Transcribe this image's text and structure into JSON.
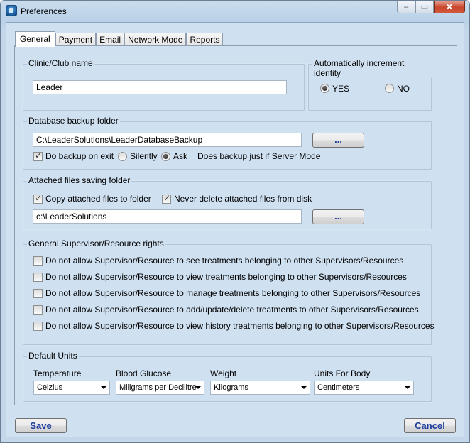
{
  "window": {
    "title": "Preferences",
    "minimize_glyph": "‒",
    "maximize_glyph": "▭",
    "close_glyph": "✕"
  },
  "tabs": [
    {
      "label": "General",
      "active": true
    },
    {
      "label": "Payment",
      "active": false
    },
    {
      "label": "Email",
      "active": false
    },
    {
      "label": "Network Mode",
      "active": false
    },
    {
      "label": "Reports",
      "active": false
    }
  ],
  "clinic": {
    "group_title": "Clinic/Club name",
    "name_value": "Leader"
  },
  "identity": {
    "group_title": "Automatically increment identity",
    "yes_label": "YES",
    "no_label": "NO",
    "selected": "YES"
  },
  "backup": {
    "group_title": "Database backup folder",
    "folder_value": "C:\\LeaderSolutions\\LeaderDatabaseBackup",
    "browse_label": "...",
    "backup_on_exit_label": "Do backup on exit",
    "backup_on_exit_checked": true,
    "silently_label": "Silently",
    "ask_label": "Ask",
    "mode_selected": "Ask",
    "note": "Does backup just if Server Mode"
  },
  "attached": {
    "group_title": "Attached files saving folder",
    "copy_label": "Copy attached files to folder",
    "copy_checked": true,
    "never_delete_label": "Never delete attached files from disk",
    "never_delete_checked": true,
    "folder_value": "c:\\LeaderSolutions",
    "browse_label": "..."
  },
  "rights": {
    "group_title": "General Supervisor/Resource rights",
    "items": [
      {
        "label": "Do not allow Supervisor/Resource to see treatments belonging to other Supervisors/Resources",
        "checked": false
      },
      {
        "label": "Do not allow Supervisor/Resource to view treatments belonging to other Supervisors/Resources",
        "checked": false
      },
      {
        "label": "Do not allow Supervisor/Resource to manage treatments belonging to other Supervisors/Resources",
        "checked": false
      },
      {
        "label": "Do not allow Supervisor/Resource to add/update/delete treatments to other Supervisors/Resources",
        "checked": false
      },
      {
        "label": "Do not allow Supervisor/Resource to view history treatments belonging to other Supervisors/Resources",
        "checked": false
      }
    ]
  },
  "units": {
    "group_title": "Default Units",
    "temperature": {
      "label": "Temperature",
      "value": "Celzius"
    },
    "glucose": {
      "label": "Blood Glucose",
      "value": "Miligrams per Decilitre"
    },
    "weight": {
      "label": "Weight",
      "value": "Kilograms"
    },
    "body": {
      "label": "Units For Body",
      "value": "Centimeters"
    }
  },
  "footer": {
    "save_label": "Save",
    "cancel_label": "Cancel"
  },
  "colors": {
    "button_text": "#1d3c9c",
    "client_background": "#cfe0f1",
    "close_button": "#c8462d"
  }
}
